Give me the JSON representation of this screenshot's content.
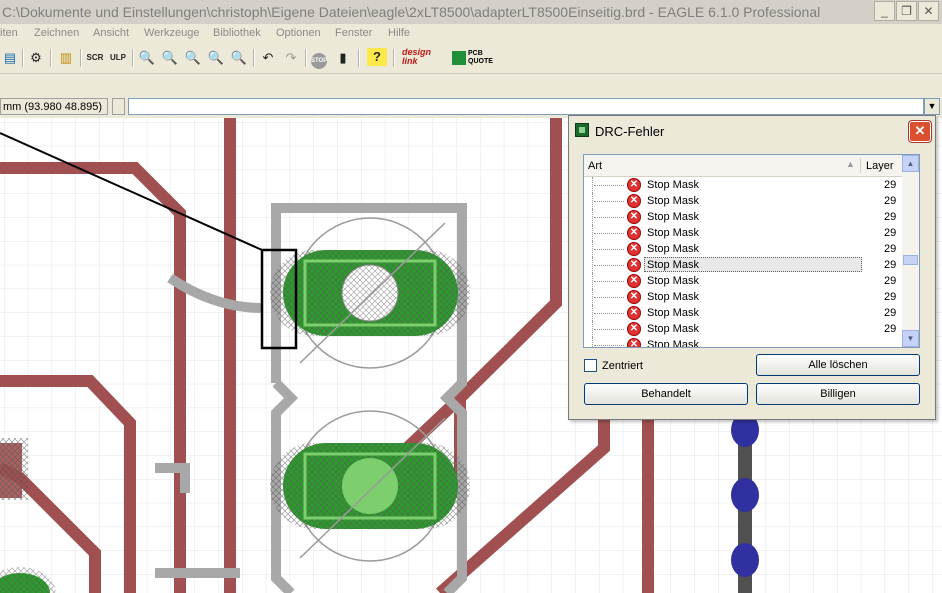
{
  "window": {
    "title": "C:\\Dokumente und Einstellungen\\christoph\\Eigene Dateien\\eagle\\2xLT8500\\adapterLT8500Einseitig.brd - EAGLE 6.1.0 Professional",
    "minimize": "_",
    "restore": "❐",
    "close": "✕"
  },
  "menu": [
    "iten",
    "Zeichnen",
    "Ansicht",
    "Werkzeuge",
    "Bibliothek",
    "Optionen",
    "Fenster",
    "Hilfe"
  ],
  "toolbar": {
    "icons": [
      "layers-icon",
      "ratsnest-icon",
      "open-icon",
      "script-icon",
      "ulp-icon",
      "zoom-fit-icon",
      "zoom-in-icon",
      "zoom-out-icon",
      "zoom-redraw-icon",
      "zoom-select-icon",
      "undo-icon",
      "redo-icon",
      "stop-icon",
      "go-icon",
      "help-icon"
    ],
    "designlink": "design link",
    "pcbquote": "PCB QUOTE"
  },
  "command": {
    "coordinate": "mm (93.980 48.895)",
    "value": ""
  },
  "dialog": {
    "title": "DRC-Fehler",
    "close": "✕",
    "col_type": "Art",
    "col_layer": "Layer",
    "rows": [
      {
        "type": "Stop Mask",
        "layer": "29"
      },
      {
        "type": "Stop Mask",
        "layer": "29"
      },
      {
        "type": "Stop Mask",
        "layer": "29"
      },
      {
        "type": "Stop Mask",
        "layer": "29"
      },
      {
        "type": "Stop Mask",
        "layer": "29"
      },
      {
        "type": "Stop Mask",
        "layer": "29"
      },
      {
        "type": "Stop Mask",
        "layer": "29"
      },
      {
        "type": "Stop Mask",
        "layer": "29"
      },
      {
        "type": "Stop Mask",
        "layer": "29"
      },
      {
        "type": "Stop Mask",
        "layer": "29"
      },
      {
        "type": "Stop Mask",
        "layer": ""
      }
    ],
    "selected_index": 5,
    "centered_label": "Zentriert",
    "centered_checked": false,
    "clear_all": "Alle löschen",
    "processed": "Behandelt",
    "approve": "Billigen"
  },
  "colors": {
    "copper_track": "#a05050",
    "pad_green": "#2e9a2e",
    "outline_gray": "#a8a8a8",
    "via_blue": "#3030a0",
    "grid": "#e4e4e4"
  }
}
